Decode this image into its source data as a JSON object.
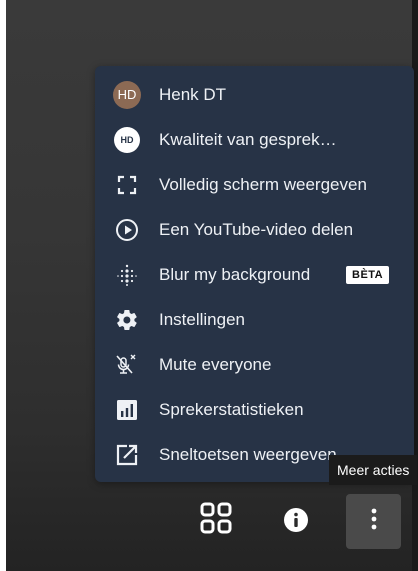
{
  "menu": {
    "items": [
      {
        "label": "Henk DT",
        "icon": "avatar-photo-icon",
        "avatar_initials": "HD"
      },
      {
        "label": "Kwaliteit van gesprek…",
        "icon": "hd-quality-icon",
        "badge_text": "HD"
      },
      {
        "label": "Volledig scherm weergeven",
        "icon": "fullscreen-icon"
      },
      {
        "label": "Een YouTube-video delen",
        "icon": "play-circle-icon"
      },
      {
        "label": "Blur my background",
        "icon": "blur-dots-icon",
        "tag": "BÈTA"
      },
      {
        "label": "Instellingen",
        "icon": "gear-icon"
      },
      {
        "label": "Mute everyone",
        "icon": "mute-everyone-icon"
      },
      {
        "label": "Sprekerstatistieken",
        "icon": "bar-chart-icon"
      },
      {
        "label": "Sneltoetsen weergeven",
        "icon": "open-external-icon"
      }
    ]
  },
  "tooltip": {
    "text": "Meer acties"
  },
  "toolbar": {
    "buttons": [
      {
        "name": "tile-view",
        "icon": "grid-icon"
      },
      {
        "name": "info",
        "icon": "info-icon"
      },
      {
        "name": "more-actions",
        "icon": "vertical-dots-icon"
      }
    ]
  },
  "colors": {
    "menu_bg": "#273346",
    "text": "#eef1f5",
    "background_top": "#3a3a3a",
    "background_bottom": "#232323",
    "tooltip_bg": "#1b1b1b",
    "active_button_bg": "#4a4a4a"
  }
}
